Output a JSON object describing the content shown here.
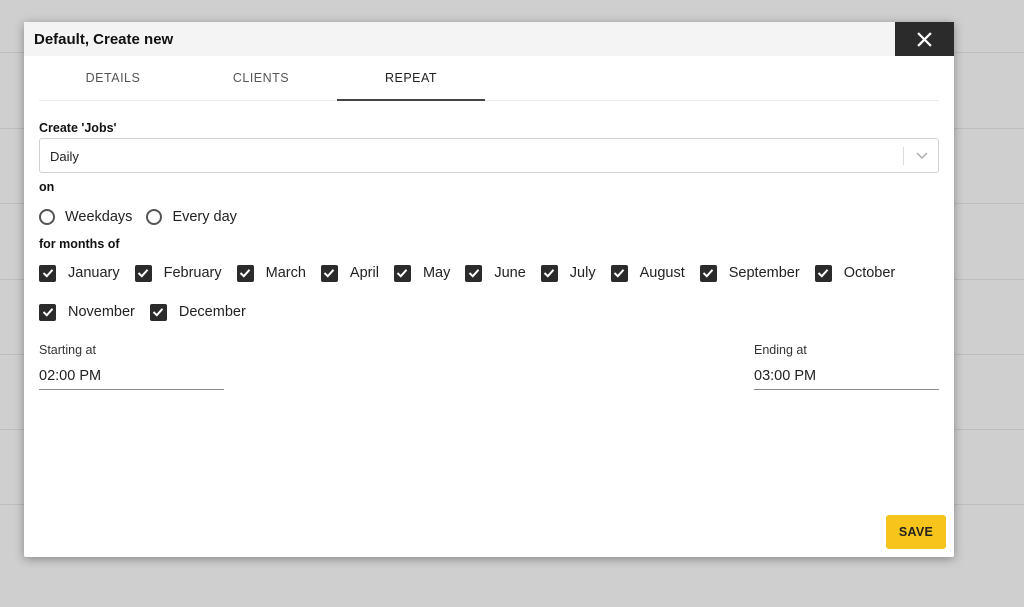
{
  "dialog": {
    "title": "Default, Create new",
    "close_icon": "close-icon"
  },
  "tabs": [
    {
      "label": "DETAILS",
      "active": false
    },
    {
      "label": "CLIENTS",
      "active": false
    },
    {
      "label": "REPEAT",
      "active": true
    }
  ],
  "repeat": {
    "create_label": "Create 'Jobs'",
    "frequency_value": "Daily",
    "on_label": "on",
    "on_options": [
      {
        "label": "Weekdays",
        "selected": false
      },
      {
        "label": "Every day",
        "selected": false
      }
    ],
    "months_label": "for months of",
    "months": [
      {
        "label": "January",
        "checked": true
      },
      {
        "label": "February",
        "checked": true
      },
      {
        "label": "March",
        "checked": true
      },
      {
        "label": "April",
        "checked": true
      },
      {
        "label": "May",
        "checked": true
      },
      {
        "label": "June",
        "checked": true
      },
      {
        "label": "July",
        "checked": true
      },
      {
        "label": "August",
        "checked": true
      },
      {
        "label": "September",
        "checked": true
      },
      {
        "label": "October",
        "checked": true
      },
      {
        "label": "November",
        "checked": true
      },
      {
        "label": "December",
        "checked": true
      }
    ],
    "start_label": "Starting at",
    "start_value": "02:00 PM",
    "end_label": "Ending at",
    "end_value": "03:00 PM"
  },
  "footer": {
    "save_label": "SAVE"
  },
  "colors": {
    "accent": "#f7c41b",
    "close_bg": "#2b2b2b",
    "checkbox": "#2b2b2b"
  }
}
